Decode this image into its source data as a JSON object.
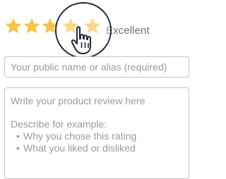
{
  "rating": {
    "label": "Excellent",
    "value": 5,
    "max": 5,
    "star_color": "#f7c34b",
    "stars": [
      {
        "name": "star-1-icon"
      },
      {
        "name": "star-2-icon"
      },
      {
        "name": "star-3-icon"
      },
      {
        "name": "star-4-icon"
      },
      {
        "name": "star-5-icon"
      }
    ]
  },
  "name_field": {
    "placeholder": "Your public name or alias (required)",
    "value": ""
  },
  "review_field": {
    "placeholder_line": "Write your product review here",
    "hint_heading": "Describe for example:",
    "hints": [
      "Why you chose this rating",
      "What you liked or disliked"
    ],
    "bullet": "•"
  },
  "icons": {
    "cursor": "hand-pointer-icon",
    "focus": "magnifier-ring"
  },
  "colors": {
    "ring": "#1c2a3a",
    "border": "#c4c4c4",
    "text": "#9a9a9a"
  }
}
